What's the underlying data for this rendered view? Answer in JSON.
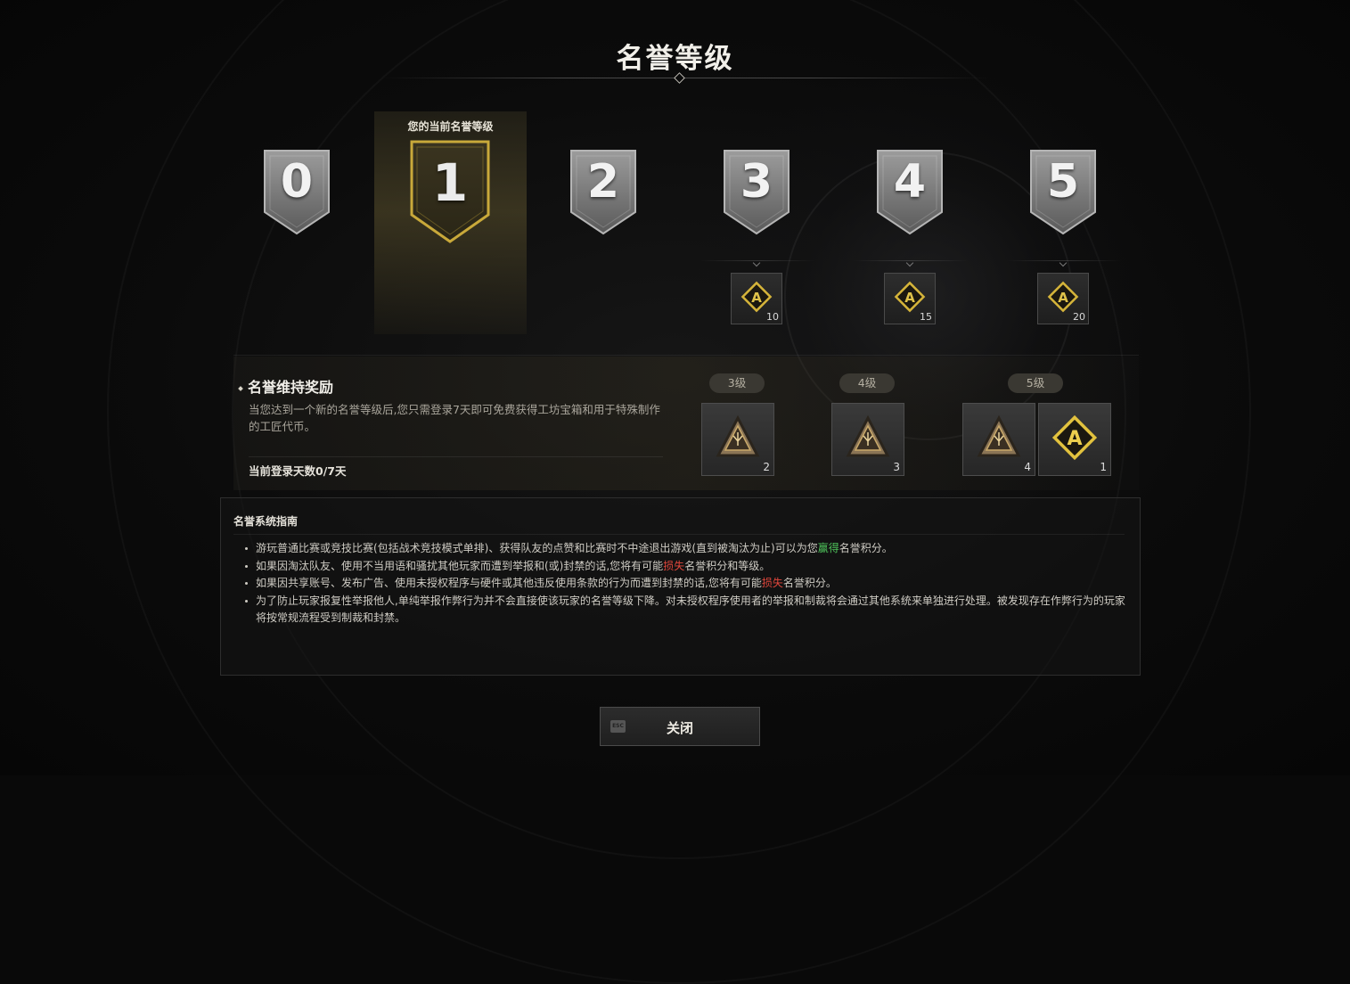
{
  "header": {
    "title": "名誉等级"
  },
  "current_rank": {
    "label": "您的当前名誉等级",
    "level": "1"
  },
  "ranks": [
    {
      "level": "0"
    },
    {
      "level": "1",
      "current": true
    },
    {
      "level": "2"
    },
    {
      "level": "3",
      "reward": {
        "icon": "a-coin-icon",
        "qty": "10"
      }
    },
    {
      "level": "4",
      "reward": {
        "icon": "a-coin-icon",
        "qty": "15"
      }
    },
    {
      "level": "5",
      "reward": {
        "icon": "a-coin-icon",
        "qty": "20"
      }
    }
  ],
  "maintenance": {
    "heading": "名誉维持奖励",
    "description": "当您达到一个新的名誉等级后,您只需登录7天即可免费获得工坊宝箱和用于特殊制作的工匠代币。",
    "days_label": "当前登录天数0/7天",
    "rewards": [
      {
        "level_label": "3级",
        "items": [
          {
            "icon": "workshop-chest-icon",
            "qty": "2"
          }
        ]
      },
      {
        "level_label": "4级",
        "items": [
          {
            "icon": "workshop-chest-icon",
            "qty": "3"
          }
        ]
      },
      {
        "level_label": "5级",
        "items": [
          {
            "icon": "workshop-chest-icon",
            "qty": "4"
          },
          {
            "icon": "a-coin-icon",
            "qty": "1"
          }
        ]
      }
    ]
  },
  "guide": {
    "title": "名誉系统指南",
    "items": [
      {
        "pre": "游玩普通比赛或竞技比赛(包括战术竞技模式单排)、获得队友的点赞和比赛时不中途退出游戏(直到被淘汰为止)可以为您",
        "highlight": "赢得",
        "post": "名誉积分。"
      },
      {
        "pre": "如果因淘汰队友、使用不当用语和骚扰其他玩家而遭到举报和(或)封禁的话,您将有可能",
        "highlight": "损失",
        "post": "名誉积分和等级。"
      },
      {
        "pre": "如果因共享账号、发布广告、使用未授权程序与硬件或其他违反使用条款的行为而遭到封禁的话,您将有可能",
        "highlight": "损失",
        "post": "名誉积分。"
      },
      {
        "pre": "为了防止玩家报复性举报他人,单纯举报作弊行为并不会直接使该玩家的名誉等级下降。对未授权程序使用者的举报和制裁将会通过其他系统来单独进行处理。被发现存在作弊行为的玩家将按常规流程受到制裁和封禁。",
        "highlight": "",
        "post": ""
      }
    ]
  },
  "footer": {
    "esc_key": "ESC",
    "close_label": "关闭"
  },
  "colors": {
    "gold": "#c9a93a",
    "silver": "#8c8c8c",
    "earn": "#4ec25a",
    "lose": "#e0473c"
  }
}
